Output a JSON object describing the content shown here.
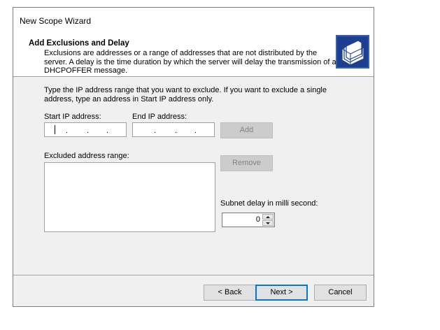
{
  "window": {
    "title": "New Scope Wizard"
  },
  "header": {
    "title": "Add Exclusions and Delay",
    "description": "Exclusions are addresses or a range of addresses that are not distributed by the server. A delay is the time duration by which the server will delay the transmission of a DHCPOFFER message.",
    "icon": "folder-stack-icon"
  },
  "body": {
    "instructions": "Type the IP address range that you want to exclude. If you want to exclude a single address, type an address in Start IP address only.",
    "start_ip": {
      "label": "Start IP address:",
      "value": ""
    },
    "end_ip": {
      "label": "End IP address:",
      "value": ""
    },
    "add_label": "Add",
    "excluded_label": "Excluded address range:",
    "excluded_items": [],
    "remove_label": "Remove",
    "delay_label": "Subnet delay in milli second:",
    "delay_value": "0"
  },
  "footer": {
    "back_label": "< Back",
    "next_label": "Next >",
    "cancel_label": "Cancel"
  },
  "colors": {
    "default_button_border": "#0078d7",
    "dialog_background": "#f0f0f0"
  }
}
